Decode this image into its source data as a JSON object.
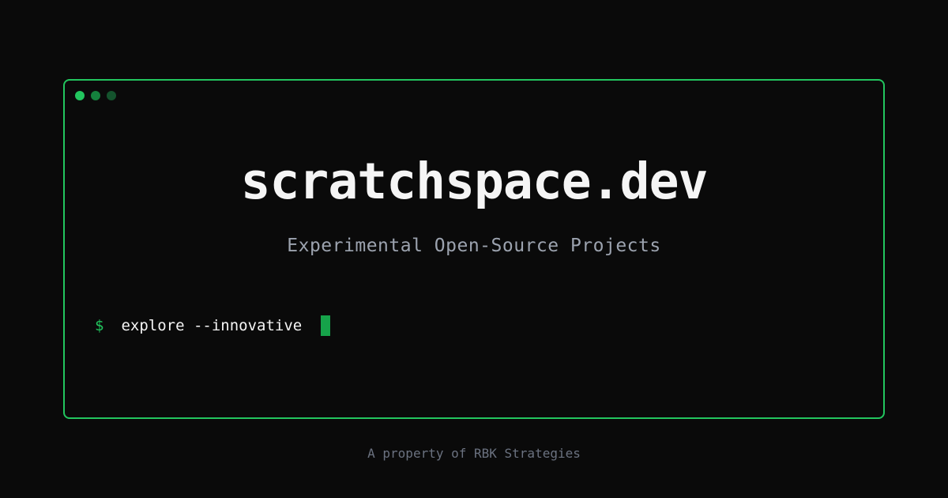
{
  "window": {
    "dots": [
      {
        "name": "window-dot-1",
        "color": "#22c55e"
      },
      {
        "name": "window-dot-2",
        "color": "#15803d"
      },
      {
        "name": "window-dot-3",
        "color": "#14532d"
      }
    ],
    "border_color": "#22c55e"
  },
  "hero": {
    "title": "scratchspace.dev",
    "subtitle": "Experimental Open-Source Projects"
  },
  "terminal": {
    "prompt_symbol": "$",
    "command": "explore --innovative",
    "cursor_color": "#16a34a"
  },
  "footer": {
    "text": "A property of RBK Strategies"
  }
}
